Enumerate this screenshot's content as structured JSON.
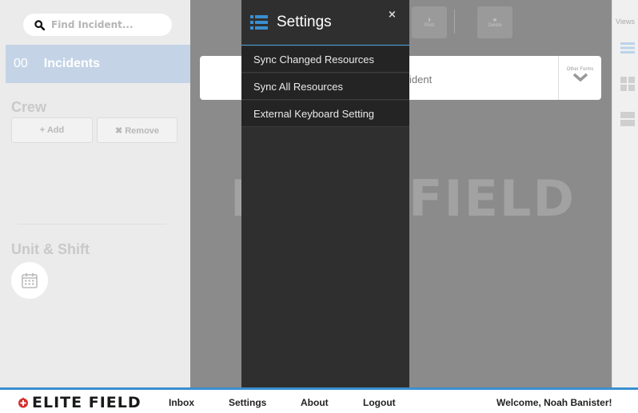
{
  "search": {
    "placeholder": "Find Incident..."
  },
  "incidents": {
    "count": "00",
    "label": "Incidents"
  },
  "crew": {
    "title": "Crew",
    "add_label": "+ Add",
    "remove_label": "✖ Remove"
  },
  "unit": {
    "title": "Unit & Shift"
  },
  "background": {
    "watermark": "ELITE FIELD",
    "form_text": "ident",
    "other_forms_label": "Other Forms"
  },
  "toolbar": {
    "post_label": "Post",
    "delete_label": "Delete"
  },
  "views": {
    "label": "Views"
  },
  "settings": {
    "title": "Settings",
    "close": "×",
    "items": [
      {
        "label": "Sync Changed Resources"
      },
      {
        "label": "Sync All Resources"
      },
      {
        "label": "External Keyboard Setting"
      }
    ]
  },
  "footer": {
    "logo": "ELITE FIELD",
    "links": [
      {
        "label": "Inbox"
      },
      {
        "label": "Settings"
      },
      {
        "label": "About"
      },
      {
        "label": "Logout"
      }
    ],
    "welcome": "Welcome, Noah Banister!"
  },
  "colors": {
    "accent": "#3a8fd0",
    "drawer_bg": "#2f2f2f",
    "incidents_highlight": "#c4d4e6",
    "logo_red": "#d32f2f"
  }
}
